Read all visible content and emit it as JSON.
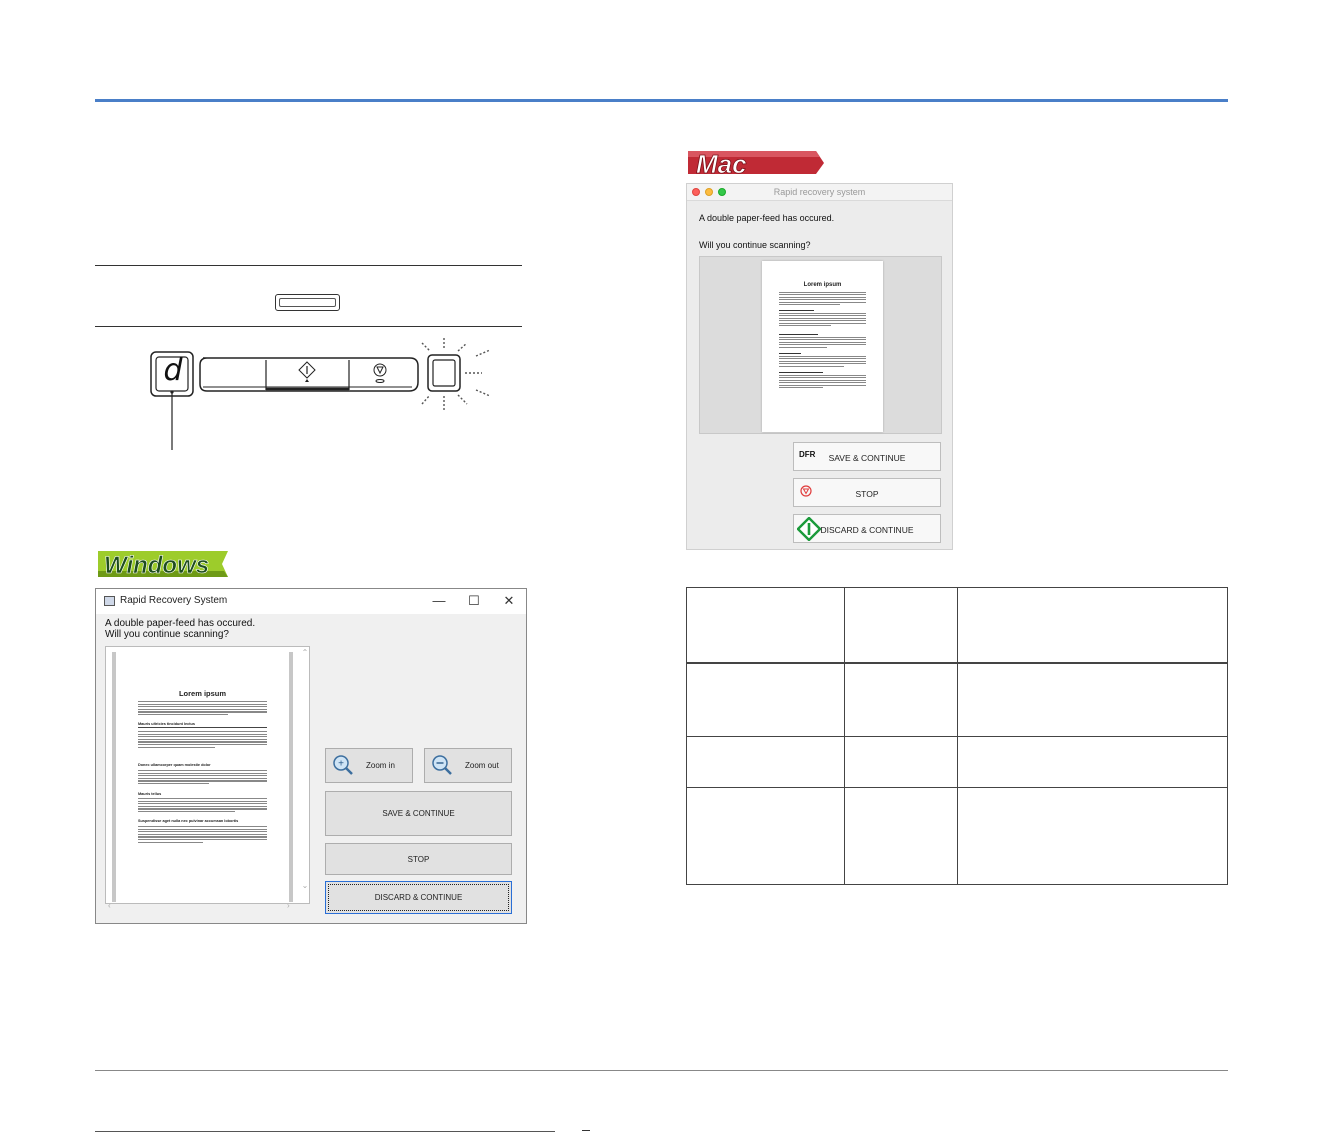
{
  "windows_badge": {
    "label": "Windows"
  },
  "mac_badge": {
    "label": "Mac"
  },
  "panel": {
    "display_char": "d"
  },
  "windows_dialog": {
    "title": "Rapid Recovery System",
    "message_line1": "A double paper-feed has occured.",
    "message_line2": "Will you continue scanning?",
    "preview_title": "Lorem ipsum",
    "preview_headings": [
      "Mauris ultricies tincidunt lectus",
      "Donec ullamcorper quam molestie dolor",
      "Mauris tellus",
      "Suspendisse aget nulla nec pulvinar accumsan lobortis"
    ],
    "zoom_in_label": "Zoom in",
    "zoom_out_label": "Zoom out",
    "save_continue_label": "SAVE & CONTINUE",
    "stop_label": "STOP",
    "discard_continue_label": "DISCARD & CONTINUE",
    "controls": {
      "minimize": "—",
      "maximize": "☐",
      "close": "✕"
    }
  },
  "mac_dialog": {
    "title": "Rapid recovery system",
    "message_line1": "A double paper-feed has occured.",
    "message_line2": "Will you continue scanning?",
    "preview_title": "Lorem ipsum",
    "dfr_icon_label": "DFR",
    "save_continue_label": "SAVE & CONTINUE",
    "stop_label": "STOP",
    "discard_continue_label": "DISCARD & CONTINUE"
  },
  "table": {
    "rows": [
      [
        "",
        "",
        ""
      ],
      [
        "",
        "",
        ""
      ],
      [
        "",
        "",
        ""
      ],
      [
        "",
        "",
        ""
      ]
    ]
  },
  "colors": {
    "header_rule": "#4a7fc8",
    "windows_badge_green": "#8fc31f",
    "mac_badge_red": "#b8262f",
    "focus_blue": "#2a6fd6"
  }
}
